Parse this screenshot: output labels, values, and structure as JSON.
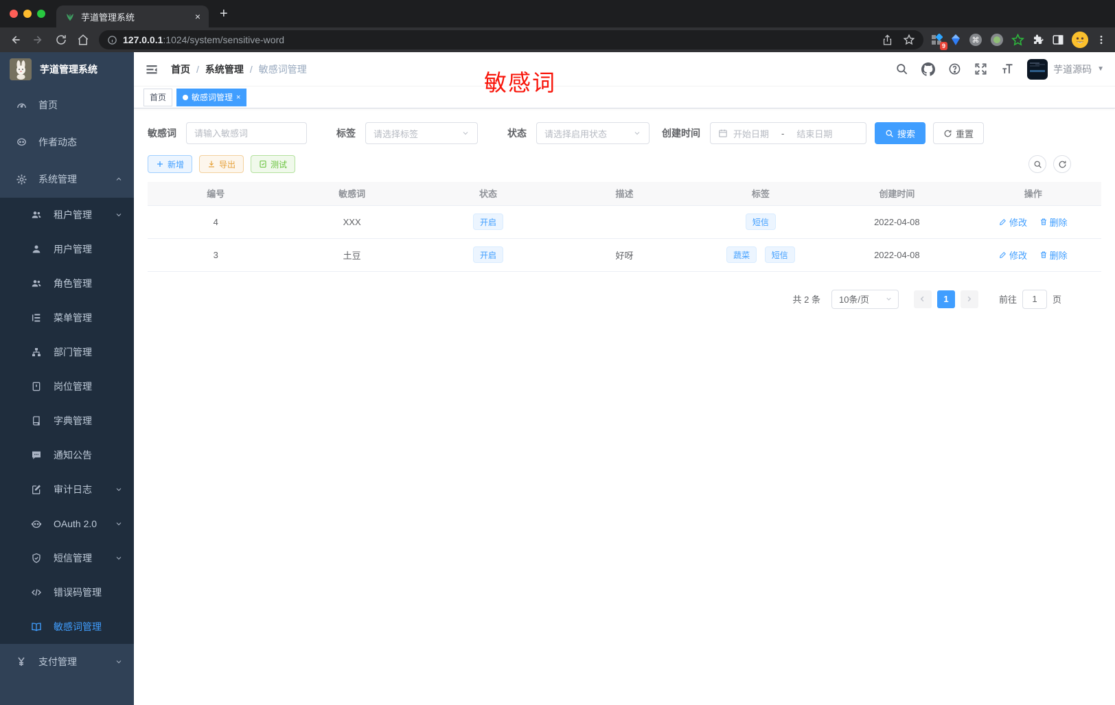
{
  "colors": {
    "primary": "#409eff",
    "annotation_red": "#f8150a",
    "success": "#67c23a",
    "warning": "#e6a23c",
    "sidebar_bg": "#304156",
    "submenu_bg": "#1f2d3d"
  },
  "browser": {
    "tab_title": "芋道管理系统",
    "tab_close": "×",
    "new_tab": "+",
    "url_host": "127.0.0.1",
    "url_rest": ":1024/system/sensitive-word",
    "ext_badge": "9"
  },
  "sidebar": {
    "title": "芋道管理系统",
    "items": [
      {
        "label": "首页"
      },
      {
        "label": "作者动态"
      },
      {
        "label": "系统管理"
      }
    ],
    "submenu": [
      {
        "label": "租户管理"
      },
      {
        "label": "用户管理"
      },
      {
        "label": "角色管理"
      },
      {
        "label": "菜单管理"
      },
      {
        "label": "部门管理"
      },
      {
        "label": "岗位管理"
      },
      {
        "label": "字典管理"
      },
      {
        "label": "通知公告"
      },
      {
        "label": "审计日志"
      },
      {
        "label": "OAuth 2.0"
      },
      {
        "label": "短信管理"
      },
      {
        "label": "错误码管理"
      },
      {
        "label": "敏感词管理"
      }
    ],
    "bottom": {
      "label": "支付管理"
    }
  },
  "navbar": {
    "breadcrumb": [
      "首页",
      "系统管理",
      "敏感词管理"
    ],
    "separator": "/",
    "username": "芋道源码"
  },
  "annotation": "敏感词",
  "tags": [
    {
      "label": "首页"
    },
    {
      "label": "敏感词管理",
      "close": "×"
    }
  ],
  "filters": {
    "word_label": "敏感词",
    "word_placeholder": "请输入敏感词",
    "tag_label": "标签",
    "tag_placeholder": "请选择标签",
    "status_label": "状态",
    "status_placeholder": "请选择启用状态",
    "time_label": "创建时间",
    "start_placeholder": "开始日期",
    "range_sep": "-",
    "end_placeholder": "结束日期",
    "search": "搜索",
    "reset": "重置"
  },
  "toolbar": {
    "add": "新增",
    "export": "导出",
    "test": "测试"
  },
  "table": {
    "headers": [
      "编号",
      "敏感词",
      "状态",
      "描述",
      "标签",
      "创建时间",
      "操作"
    ],
    "rows": [
      {
        "id": "4",
        "word": "XXX",
        "status": "开启",
        "desc": "",
        "tags": [
          "短信"
        ],
        "created": "2022-04-08"
      },
      {
        "id": "3",
        "word": "土豆",
        "status": "开启",
        "desc": "好呀",
        "tags": [
          "蔬菜",
          "短信"
        ],
        "created": "2022-04-08"
      }
    ],
    "actions": {
      "edit": "修改",
      "delete": "删除"
    }
  },
  "pagination": {
    "total": "共 2 条",
    "size": "10条/页",
    "page": "1",
    "goto": "前往",
    "goto_value": "1",
    "unit": "页"
  }
}
